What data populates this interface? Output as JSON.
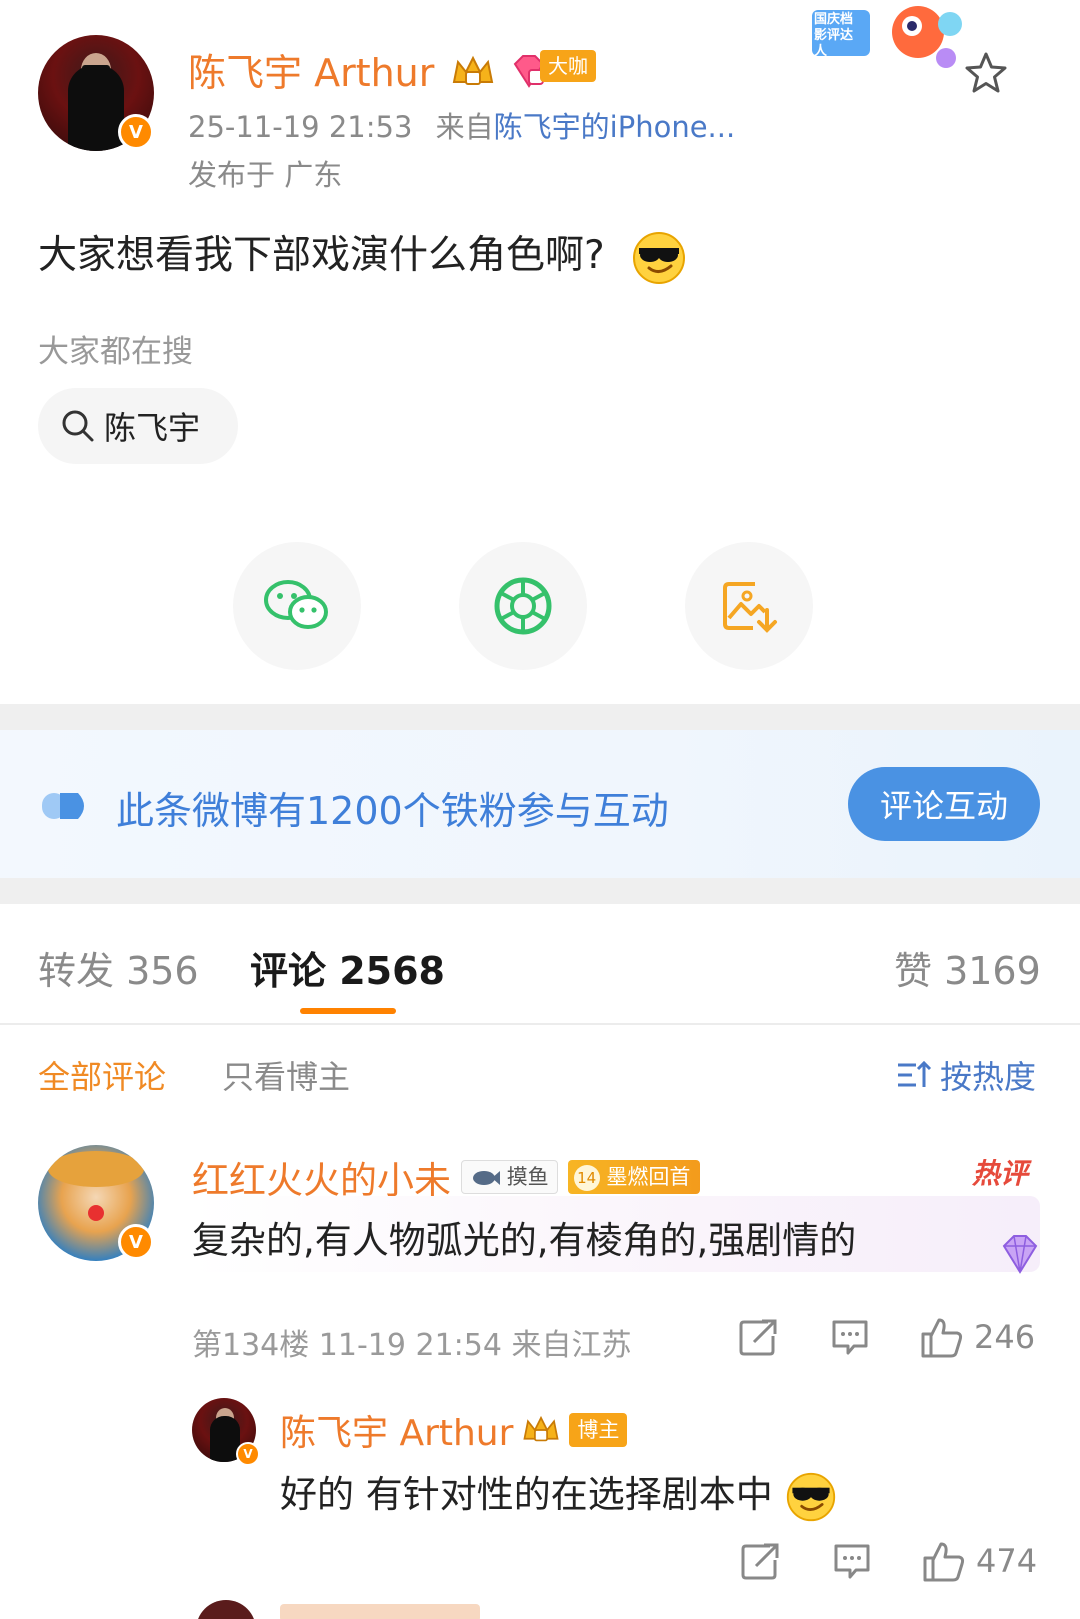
{
  "post": {
    "author": "陈飞宇 Arthur",
    "level_badge": "大咖",
    "time": "25-11-19 21:53",
    "source_prefix": "来自",
    "source": "陈飞宇的iPhone...",
    "location": "发布于 广东",
    "text": "大家想看我下部戏演什么角色啊?",
    "promo_badge": "国庆档影评达人"
  },
  "search": {
    "hint": "大家都在搜",
    "chip": "陈飞宇"
  },
  "share": {
    "items": [
      "wechat-icon",
      "moments-icon",
      "save-image-icon"
    ]
  },
  "fans_bar": {
    "text": "此条微博有1200个铁粉参与互动",
    "button": "评论互动"
  },
  "tabs": {
    "repost": "转发 356",
    "comments": "评论 2568",
    "likes": "赞 3169"
  },
  "filters": {
    "all": "全部评论",
    "owner_only": "只看博主",
    "sort": "按热度"
  },
  "comment": {
    "user": "红红火火的小未",
    "tag1": "摸鱼",
    "tag2_level": "14",
    "tag2": "墨燃回首",
    "hot": "热评",
    "text": "复杂的,有人物弧光的,有棱角的,强剧情的",
    "meta": "第134楼 11-19 21:54 来自江苏",
    "likes": "246"
  },
  "reply": {
    "user": "陈飞宇 Arthur",
    "tag": "博主",
    "text": "好的 有针对性的在选择剧本中",
    "likes": "474"
  },
  "colors": {
    "brand_orange": "#ee7a2b",
    "link_blue": "#4a79c7",
    "fans_button": "#4a92e3",
    "tab_underline": "#ff8200"
  }
}
